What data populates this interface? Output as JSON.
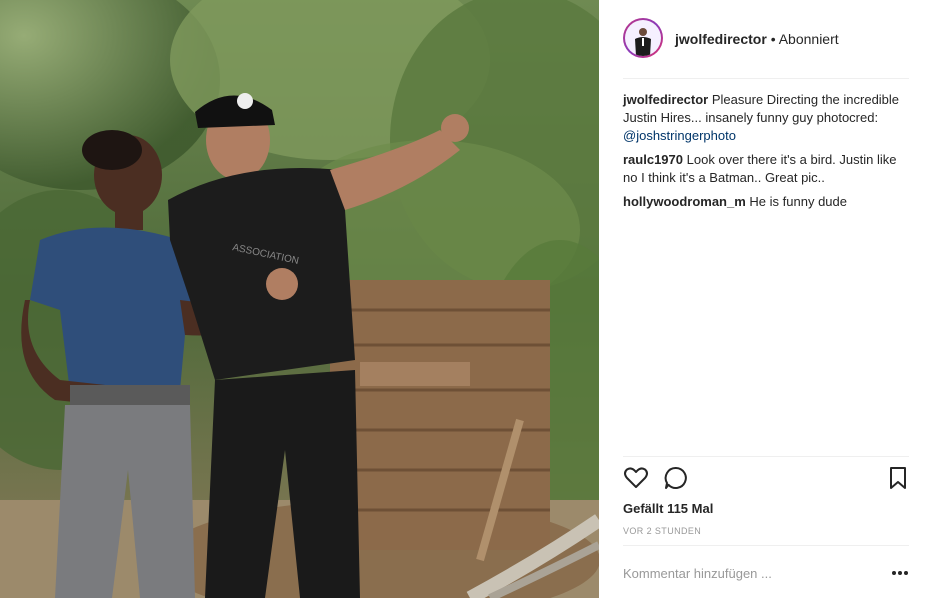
{
  "post": {
    "username": "jwolfedirector",
    "separator": "•",
    "follow_status": "Abonniert"
  },
  "comments": [
    {
      "user": "jwolfedirector",
      "text": "Pleasure Directing the incredible Justin Hires... insanely funny guy photocred: ",
      "mention": "@joshstringerphoto"
    },
    {
      "user": "raulc1970",
      "text": "Look over there it's a bird. Justin like no I think it's a Batman.. Great pic.."
    },
    {
      "user": "hollywoodroman_m",
      "text": "He is funny dude"
    }
  ],
  "actions": {
    "like_icon": "heart-icon",
    "comment_icon": "comment-icon",
    "save_icon": "bookmark-icon"
  },
  "likes_text": "Gefällt 115 Mal",
  "timestamp": "VOR 2 STUNDEN",
  "add_comment_placeholder": "Kommentar hinzufügen ...",
  "more_icon": "more-options-icon",
  "colors": {
    "link": "#003569",
    "muted": "#999999",
    "text": "#262626"
  }
}
